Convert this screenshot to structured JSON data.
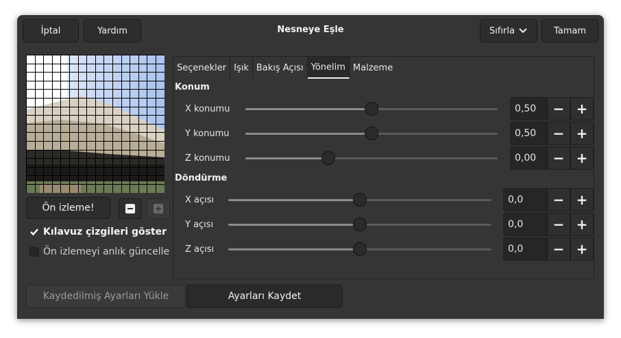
{
  "header": {
    "cancel_label": "İptal",
    "help_label": "Yardım",
    "title": "Nesneye Eşle",
    "reset_label": "Sıfırla",
    "ok_label": "Tamam"
  },
  "left": {
    "preview_button_label": "Ön izleme!",
    "zoom_out_icon": "minus-icon",
    "zoom_in_icon": "plus-icon",
    "show_guides_label": "Kılavuz çizgileri göster",
    "show_guides_checked": true,
    "live_preview_label": "Ön izlemeyi anlık güncelle",
    "live_preview_checked": false
  },
  "tabs": [
    {
      "label": "Seçenekler",
      "active": false
    },
    {
      "label": "Işık",
      "active": false
    },
    {
      "label": "Bakış Açısı",
      "active": false
    },
    {
      "label": "Yönelim",
      "active": true
    },
    {
      "label": "Malzeme",
      "active": false
    }
  ],
  "position": {
    "section_label": "Konum",
    "x": {
      "label": "X konumu",
      "value": "0,50",
      "fraction": 0.5
    },
    "y": {
      "label": "Y konumu",
      "value": "0,50",
      "fraction": 0.5
    },
    "z": {
      "label": "Z konumu",
      "value": "0,00",
      "fraction": 0.33
    }
  },
  "rotation": {
    "section_label": "Döndürme",
    "x": {
      "label": "X açısı",
      "value": "0,0",
      "fraction": 0.5
    },
    "y": {
      "label": "Y açısı",
      "value": "0,0",
      "fraction": 0.5
    },
    "z": {
      "label": "Z açısı",
      "value": "0,0",
      "fraction": 0.5
    }
  },
  "footer": {
    "load_label": "Kaydedilmiş Ayarları Yükle",
    "save_label": "Ayarları Kaydet"
  },
  "colors": {
    "dialog_bg": "#353535",
    "sky": "#a9c3ef",
    "checkbox_accent": "#ffffff"
  }
}
